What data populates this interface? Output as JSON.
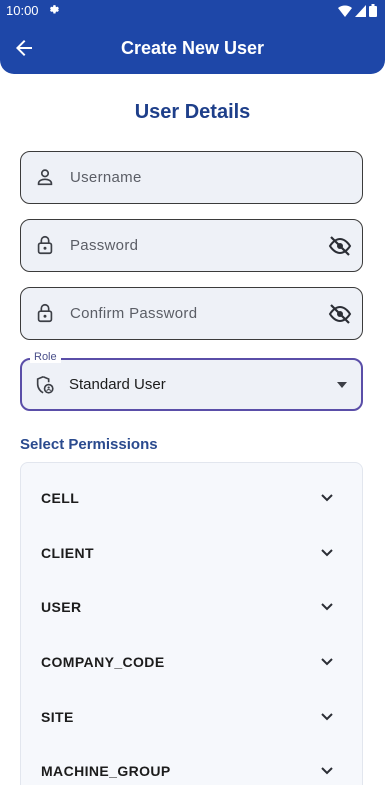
{
  "status_bar": {
    "time": "10:00",
    "icons": [
      "gear-icon",
      "wifi-icon",
      "signal-icon",
      "battery-icon"
    ]
  },
  "app_bar": {
    "title": "Create New User",
    "back_icon": "arrow-left-icon",
    "color": "#1e47a8"
  },
  "form": {
    "section_title": "User Details",
    "username": {
      "placeholder": "Username",
      "icon": "person-icon"
    },
    "password": {
      "placeholder": "Password",
      "icon": "lock-icon",
      "toggle_icon": "eye-off-icon"
    },
    "confirm_password": {
      "placeholder": "Confirm Password",
      "icon": "lock-icon",
      "toggle_icon": "eye-off-icon"
    },
    "role": {
      "label": "Role",
      "value": "Standard User",
      "icon": "shield-icon",
      "dropdown_icon": "caret-down-icon"
    }
  },
  "permissions": {
    "title": "Select Permissions",
    "items": [
      {
        "label": "CELL"
      },
      {
        "label": "CLIENT"
      },
      {
        "label": "USER"
      },
      {
        "label": "COMPANY_CODE"
      },
      {
        "label": "SITE"
      },
      {
        "label": "MACHINE_GROUP"
      }
    ]
  }
}
